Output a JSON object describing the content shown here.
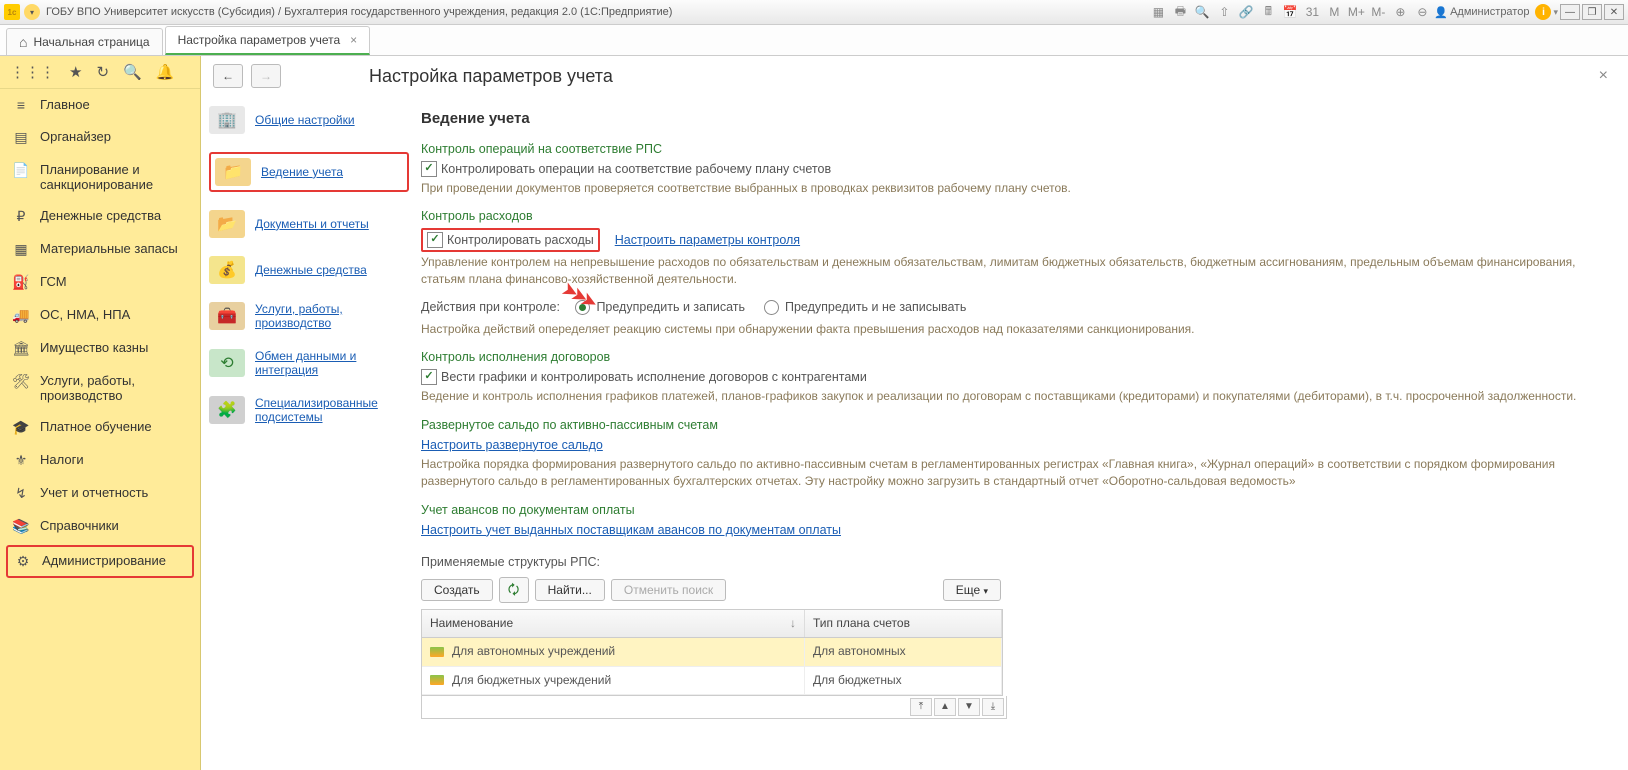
{
  "titlebar": {
    "title": "ГОБУ ВПО Университет искусств (Субсидия) / Бухгалтерия государственного учреждения, редакция 2.0  (1С:Предприятие)",
    "user": "Администратор",
    "m_labels": [
      "M",
      "M+",
      "M-"
    ]
  },
  "tabs": {
    "home": "Начальная страница",
    "active": "Настройка параметров учета"
  },
  "sidebar": {
    "items": [
      {
        "label": "Главное"
      },
      {
        "label": "Органайзер"
      },
      {
        "label": "Планирование и санкционирование"
      },
      {
        "label": "Денежные средства"
      },
      {
        "label": "Материальные запасы"
      },
      {
        "label": "ГСМ"
      },
      {
        "label": "ОС, НМА, НПА"
      },
      {
        "label": "Имущество казны"
      },
      {
        "label": "Услуги, работы, производство"
      },
      {
        "label": "Платное обучение"
      },
      {
        "label": "Налоги"
      },
      {
        "label": "Учет и отчетность"
      },
      {
        "label": "Справочники"
      },
      {
        "label": "Администрирование"
      }
    ]
  },
  "page": {
    "title": "Настройка параметров учета"
  },
  "sections": {
    "items": [
      {
        "label": "Общие настройки"
      },
      {
        "label": "Ведение учета"
      },
      {
        "label": "Документы и отчеты"
      },
      {
        "label": "Денежные средства"
      },
      {
        "label": "Услуги, работы, производство"
      },
      {
        "label": "Обмен данными и интеграция"
      },
      {
        "label": "Специализированные подсистемы"
      }
    ]
  },
  "content": {
    "heading": "Ведение учета",
    "g1": {
      "title": "Контроль операций на соответствие РПС",
      "cb": "Контролировать операции на соответствие рабочему плану счетов",
      "desc": "При проведении документов проверяется соответствие выбранных в проводках реквизитов рабочему плану счетов."
    },
    "g2": {
      "title": "Контроль расходов",
      "cb": "Контролировать расходы",
      "link": "Настроить параметры контроля",
      "desc": "Управление контролем на непревышение расходов по обязательствам и денежным обязательствам, лимитам бюджетных обязательств, бюджетным ассигнованиям, предельным объемам финансирования, статьям плана финансово-хозяйственной деятельности.",
      "actions_label": "Действия при контроле:",
      "r1": "Предупредить и записать",
      "r2": "Предупредить и не записывать",
      "desc2": "Настройка действий опеределяет реакцию системы при обнаружении факта превышения расходов над показателями санкционирования."
    },
    "g3": {
      "title": "Контроль исполнения договоров",
      "cb": "Вести графики и контролировать исполнение договоров с контрагентами",
      "desc": "Ведение и контроль исполнения графиков платежей, планов-графиков закупок и реализации по договорам с поставщиками (кредиторами) и покупателями (дебиторами), в т.ч. просроченной задолженности."
    },
    "g4": {
      "title": "Развернутое сальдо по активно-пассивным счетам",
      "link": "Настроить развернутое сальдо",
      "desc": "Настройка порядка формирования развернутого сальдо по активно-пассивным счетам в регламентированных регистрах «Главная книга», «Журнал операций» в соответствии с порядком формирования развернутого сальдо в регламентированных бухгалтерских отчетах. Эту настройку можно загрузить в стандартный отчет «Оборотно-сальдовая ведомость»"
    },
    "g5": {
      "title": "Учет авансов по документам оплаты",
      "link": "Настроить учет выданных поставщикам авансов по документам оплаты"
    },
    "rps_label": "Применяемые структуры РПС:",
    "buttons": {
      "create": "Создать",
      "find": "Найти...",
      "cancel_find": "Отменить поиск",
      "more": "Еще"
    },
    "table": {
      "h1": "Наименование",
      "h2": "Тип плана счетов",
      "rows": [
        {
          "name": "Для автономных учреждений",
          "type": "Для автономных"
        },
        {
          "name": "Для бюджетных учреждений",
          "type": "Для бюджетных"
        }
      ]
    }
  }
}
